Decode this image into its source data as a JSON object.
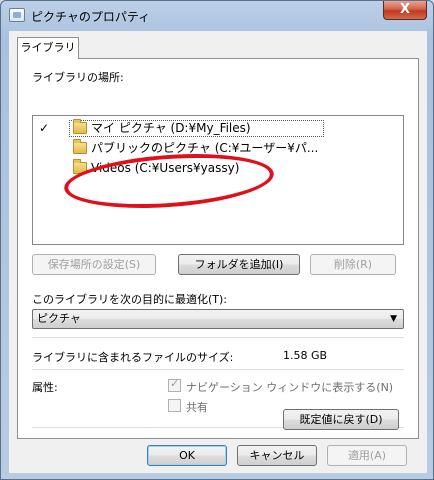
{
  "window": {
    "title": "ピクチャのプロパティ",
    "close": "X"
  },
  "tab": {
    "label": "ライブラリ"
  },
  "locations": {
    "heading": "ライブラリの場所:",
    "items": [
      {
        "check": "✓",
        "label": "マイ ピクチャ (D:¥My_Files)"
      },
      {
        "check": "",
        "label": "パブリックのピクチャ (C:¥ユーザー¥パ..."
      },
      {
        "check": "",
        "label": "Videos (C:¥Users¥yassy)"
      }
    ]
  },
  "buttons": {
    "save_location": "保存場所の設定(S)",
    "add_folder": "フォルダを追加(I)",
    "remove": "削除(R)",
    "restore_defaults": "既定値に戻す(D)",
    "ok": "OK",
    "cancel": "キャンセル",
    "apply": "適用(A)"
  },
  "optimize": {
    "label": "このライブラリを次の目的に最適化(T):",
    "value": "ピクチャ"
  },
  "size": {
    "label": "ライブラリに含まれるファイルのサイズ:",
    "value": "1.58 GB"
  },
  "attributes": {
    "label": "属性:",
    "show_nav": {
      "label": "ナビゲーション ウィンドウに表示する(N)",
      "checked": true
    },
    "shared": {
      "label": "共有",
      "checked": false
    }
  },
  "colors": {
    "annotation": "#e0101a",
    "title_close": "#c0391f"
  }
}
